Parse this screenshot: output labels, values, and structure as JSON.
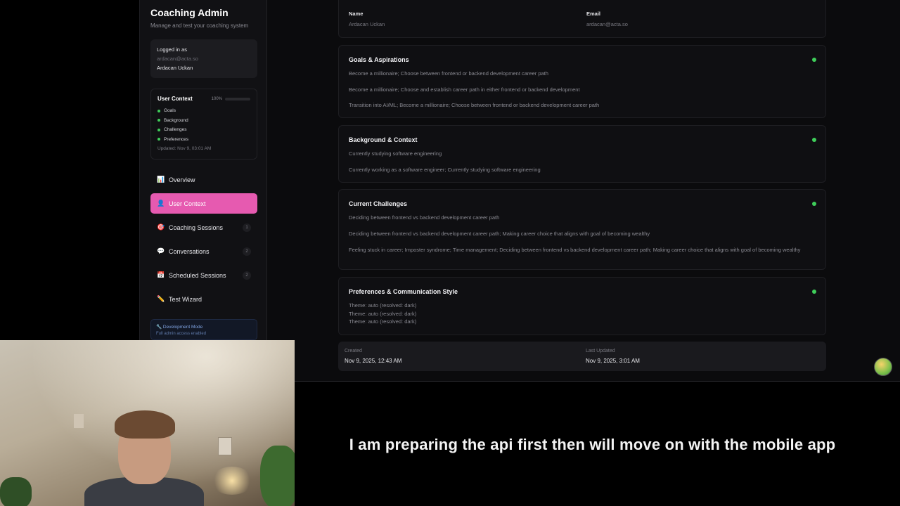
{
  "sidebar": {
    "title": "Coaching Admin",
    "subtitle": "Manage and test your coaching system",
    "login": {
      "label": "Logged in as",
      "email": "ardacan@acta.so",
      "name": "Ardacan Uckan"
    },
    "user_context": {
      "title": "User Context",
      "percent_label": "100%",
      "progress": 1.0,
      "items": [
        "Goals",
        "Background",
        "Challenges",
        "Preferences"
      ],
      "updated": "Updated: Nov 9, 03:01 AM"
    },
    "nav": [
      {
        "label": "Overview",
        "icon": "chart-icon",
        "glyph": "📊",
        "count": null
      },
      {
        "label": "User Context",
        "icon": "user-icon",
        "glyph": "👤",
        "count": null,
        "active": true
      },
      {
        "label": "Coaching Sessions",
        "icon": "target-icon",
        "glyph": "🎯",
        "count": "1"
      },
      {
        "label": "Conversations",
        "icon": "speech-bubble-icon",
        "glyph": "💬",
        "count": "2"
      },
      {
        "label": "Scheduled Sessions",
        "icon": "calendar-icon",
        "glyph": "📅",
        "count": "2"
      },
      {
        "label": "Test Wizard",
        "icon": "pencil-icon",
        "glyph": "✏️",
        "count": null
      }
    ],
    "dev": {
      "title": "🔧 Development Mode",
      "subtitle": "Full admin access enabled"
    }
  },
  "basic": {
    "name_label": "Name",
    "name_value": "Ardacan Uckan",
    "email_label": "Email",
    "email_value": "ardacan@acta.so"
  },
  "sections": {
    "goals": {
      "title": "Goals & Aspirations",
      "lines": [
        "Become a millionaire; Choose between frontend or backend development career path",
        "Become a millionaire; Choose and establish career path in either frontend or backend development",
        "Transition into AI/ML; Become a millionaire; Choose between frontend or backend development career path"
      ]
    },
    "background": {
      "title": "Background & Context",
      "lines": [
        "Currently studying software engineering",
        "Currently working as a software engineer; Currently studying software engineering"
      ]
    },
    "challenges": {
      "title": "Current Challenges",
      "lines": [
        "Deciding between frontend vs backend development career path",
        "Deciding between frontend vs backend development career path; Making career choice that aligns with goal of becoming wealthy",
        "Feeling stuck in career; Imposter syndrome; Time management; Deciding between frontend vs backend development career path; Making career choice that aligns with goal of becoming wealthy"
      ]
    },
    "preferences": {
      "title": "Preferences & Communication Style",
      "lines": [
        "Theme: auto (resolved: dark)",
        "Theme: auto (resolved: dark)",
        "Theme: auto (resolved: dark)"
      ]
    }
  },
  "meta": {
    "created_label": "Created",
    "created_value": "Nov 9, 2025, 12:43 AM",
    "updated_label": "Last Updated",
    "updated_value": "Nov 9, 2025, 3:01 AM"
  },
  "caption": "I am preparing the api first then will move on with the mobile app",
  "colors": {
    "accent": "#e65ab0",
    "status_green": "#3fce5a",
    "background": "#0b0b0d"
  }
}
